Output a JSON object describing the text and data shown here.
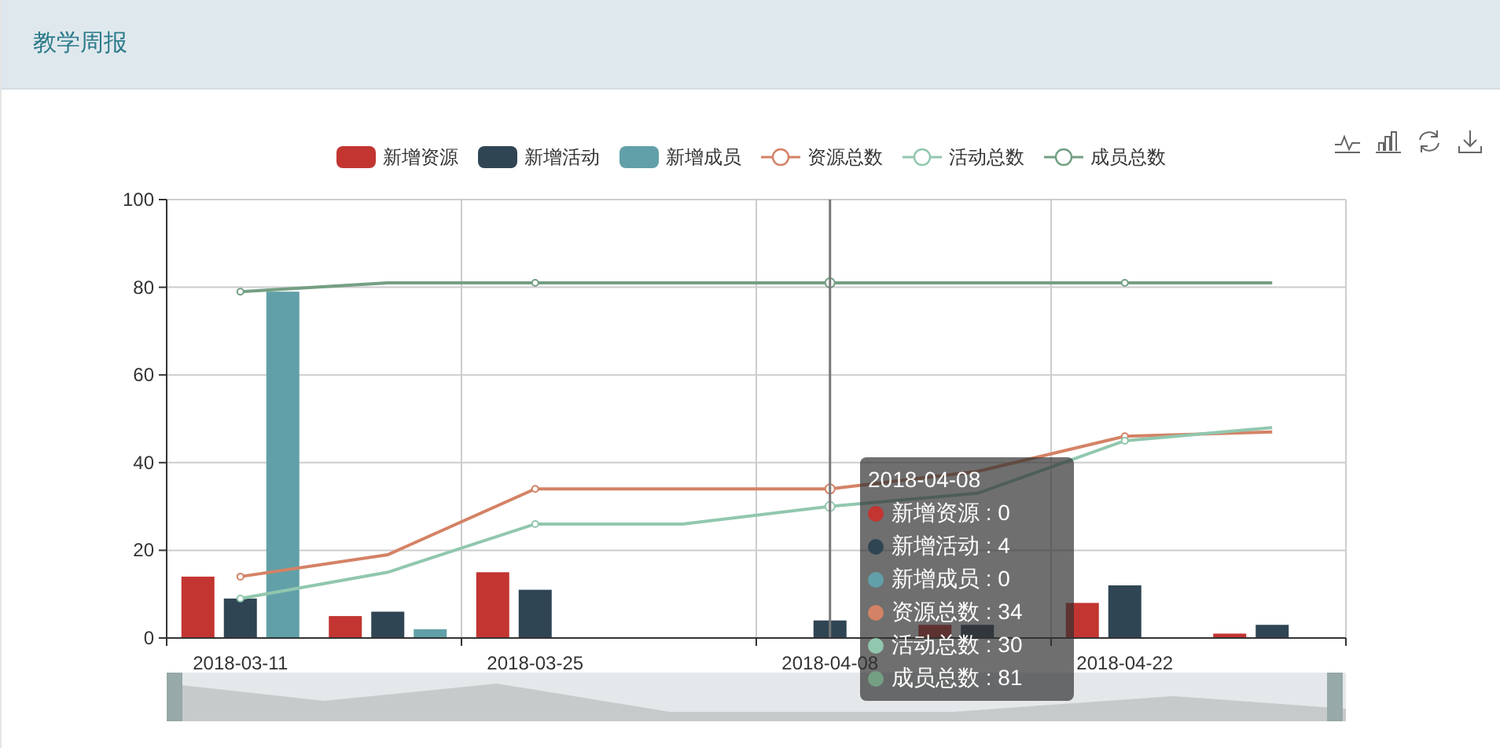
{
  "header": {
    "title": "教学周报"
  },
  "chart_data": {
    "type": "bar",
    "categories": [
      "2018-03-11",
      null,
      "2018-03-25",
      null,
      "2018-04-08",
      null,
      "2018-04-22",
      null
    ],
    "ylim": [
      0,
      100
    ],
    "grid": true,
    "yticks": [
      0,
      20,
      40,
      60,
      80,
      100
    ],
    "series": [
      {
        "name": "新增资源",
        "color": "#c23531",
        "values": [
          14,
          5,
          15,
          0,
          0,
          3,
          8,
          1
        ]
      },
      {
        "name": "新增活动",
        "color": "#2f4554",
        "values": [
          9,
          6,
          11,
          0,
          4,
          3,
          12,
          3
        ]
      },
      {
        "name": "新增成员",
        "color": "#61a0a8",
        "values": [
          79,
          2,
          0,
          0,
          0,
          0,
          0,
          0
        ]
      },
      {
        "name": "资源总数",
        "type": "line",
        "color": "#d48265",
        "values": [
          14,
          19,
          34,
          34,
          34,
          38,
          46,
          47
        ]
      },
      {
        "name": "活动总数",
        "type": "line",
        "color": "#91c7ae",
        "values": [
          9,
          15,
          26,
          26,
          30,
          33,
          45,
          48
        ]
      },
      {
        "name": "成员总数",
        "type": "line",
        "color": "#749f83",
        "values": [
          79,
          81,
          81,
          81,
          81,
          81,
          81,
          81
        ]
      }
    ]
  },
  "tooltip": {
    "title": "2018-04-08",
    "rows": [
      {
        "text": "新增资源 : 0",
        "color": "#c23531"
      },
      {
        "text": "新增活动 : 4",
        "color": "#2f4554"
      },
      {
        "text": "新增成员 : 0",
        "color": "#61a0a8"
      },
      {
        "text": "资源总数 : 34",
        "color": "#d48265"
      },
      {
        "text": "活动总数 : 30",
        "color": "#91c7ae"
      },
      {
        "text": "成员总数 : 81",
        "color": "#749f83"
      }
    ]
  }
}
